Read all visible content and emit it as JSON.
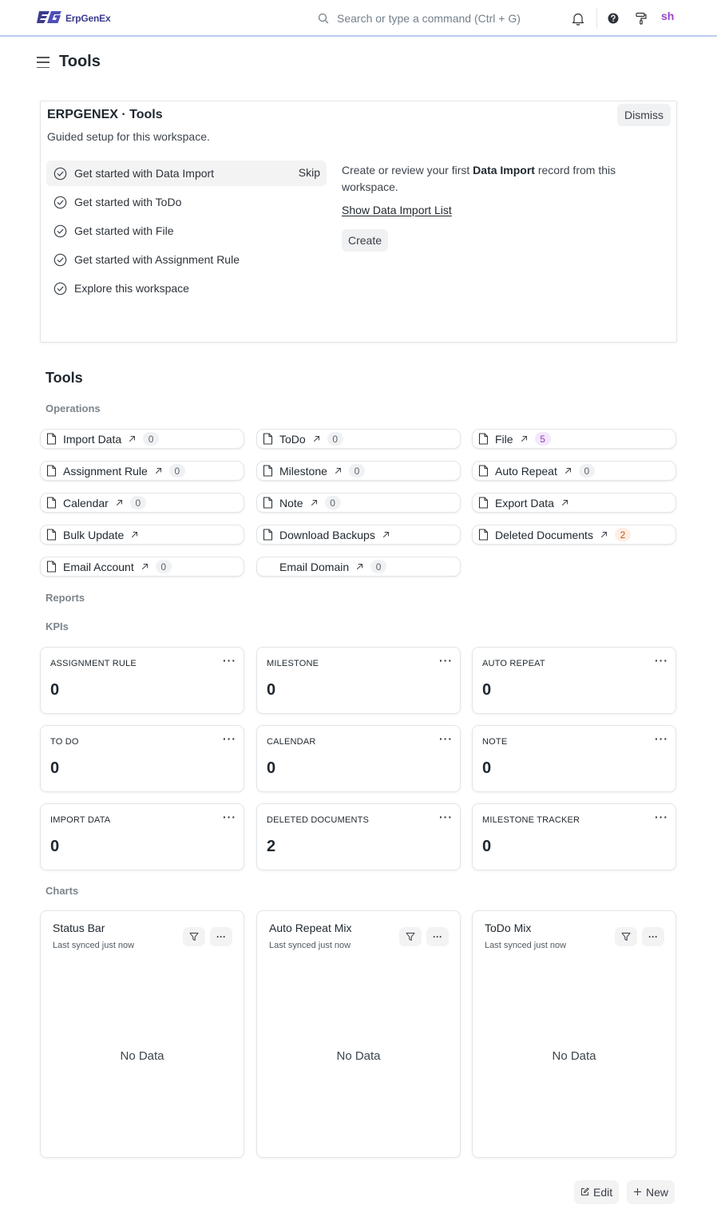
{
  "navbar": {
    "brand": "ErpGenEx",
    "search_placeholder": "Search or type a command (Ctrl + G)",
    "avatar_initials": "sh"
  },
  "page": {
    "title": "Tools"
  },
  "onboarding": {
    "title": "ERPGENEX · Tools",
    "subtitle": "Guided setup for this workspace.",
    "dismiss_label": "Dismiss",
    "skip_label": "Skip",
    "steps": [
      {
        "label": "Get started with Data Import",
        "active": true
      },
      {
        "label": "Get started with ToDo"
      },
      {
        "label": "Get started with File"
      },
      {
        "label": "Get started with Assignment Rule"
      },
      {
        "label": "Explore this workspace"
      }
    ],
    "detail": {
      "text_before": "Create or review your first ",
      "text_bold": "Data Import",
      "text_after": " record from this workspace.",
      "link_label": "Show Data Import List",
      "create_label": "Create"
    }
  },
  "section": {
    "title": "Tools",
    "operations_label": "Operations",
    "reports_label": "Reports",
    "kpis_label": "KPIs",
    "charts_label": "Charts"
  },
  "shortcuts": [
    {
      "label": "Import Data",
      "count": "0"
    },
    {
      "label": "ToDo",
      "count": "0"
    },
    {
      "label": "File",
      "count": "5",
      "count_color": "#8e3cc1"
    },
    {
      "label": "Assignment Rule",
      "count": "0"
    },
    {
      "label": "Milestone",
      "count": "0"
    },
    {
      "label": "Auto Repeat",
      "count": "0"
    },
    {
      "label": "Calendar",
      "count": "0"
    },
    {
      "label": "Note",
      "count": "0"
    },
    {
      "label": "Export Data"
    },
    {
      "label": "Bulk Update"
    },
    {
      "label": "Download Backups"
    },
    {
      "label": "Deleted Documents",
      "count": "2",
      "count_color": "#c35916"
    },
    {
      "label": "Email Account",
      "count": "0"
    },
    {
      "label": "Email Domain",
      "count": "0"
    }
  ],
  "kpis": [
    {
      "label": "ASSIGNMENT RULE",
      "value": "0"
    },
    {
      "label": "MILESTONE",
      "value": "0"
    },
    {
      "label": "AUTO REPEAT",
      "value": "0"
    },
    {
      "label": "TO DO",
      "value": "0"
    },
    {
      "label": "CALENDAR",
      "value": "0"
    },
    {
      "label": "NOTE",
      "value": "0"
    },
    {
      "label": "IMPORT DATA",
      "value": "0"
    },
    {
      "label": "DELETED DOCUMENTS",
      "value": "2"
    },
    {
      "label": "MILESTONE TRACKER",
      "value": "0"
    }
  ],
  "kpi_menu_label": "···",
  "charts": [
    {
      "title": "Status Bar",
      "subtitle": "Last synced just now",
      "empty": "No Data"
    },
    {
      "title": "Auto Repeat Mix",
      "subtitle": "Last synced just now",
      "empty": "No Data"
    },
    {
      "title": "ToDo Mix",
      "subtitle": "Last synced just now",
      "empty": "No Data"
    }
  ],
  "chart_menu_label": "···",
  "footer": {
    "edit_label": "Edit",
    "new_label": "New"
  },
  "icons": {
    "logo": "erpgenex-logo-icon",
    "search": "search-icon",
    "bell": "bell-icon",
    "help": "help-icon",
    "paint": "paint-roller-icon",
    "step": "check-circle-icon",
    "doc": "document-icon",
    "arrow": "arrow-up-right-icon",
    "filter": "filter-icon",
    "edit": "edit-icon",
    "plus": "plus-icon"
  },
  "colors": {
    "brand": "#3b3b8f",
    "accent_border": "#b9cdee",
    "avatar": "#9c45c8"
  }
}
